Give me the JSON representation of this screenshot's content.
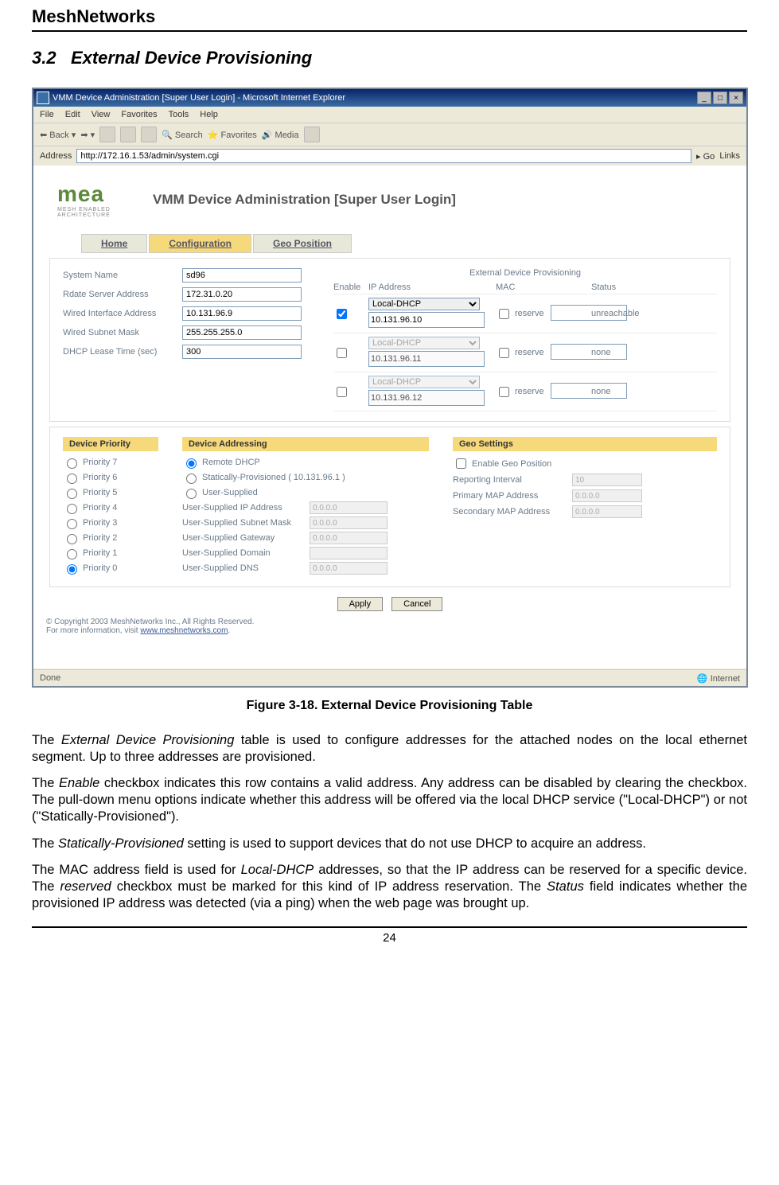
{
  "doc": {
    "header": "MeshNetworks",
    "section_number": "3.2",
    "section_title": "External Device Provisioning",
    "figure_caption": "Figure 3-18.    External Device Provisioning Table",
    "page_number": "24"
  },
  "paragraphs": {
    "p1_a": "The ",
    "p1_i": "External Device Provisioning",
    "p1_b": " table is used to configure addresses for the attached nodes on the local ethernet segment.  Up to three addresses are provisioned.",
    "p2_a": "The ",
    "p2_i": "Enable",
    "p2_b": " checkbox indicates this row contains a valid address.  Any address can be disabled by clearing the checkbox.  The pull-down menu options indicate whether this address will be offered via the local DHCP service (\"Local-DHCP\") or not (\"Statically-Provisioned\").",
    "p3_a": "The ",
    "p3_i": "Statically-Provisioned",
    "p3_b": " setting is used to support devices that do not use DHCP to acquire an address.",
    "p4_a": "The MAC address field is used for ",
    "p4_i1": "Local-DHCP",
    "p4_b": " addresses, so that the IP address can be reserved for a specific device.  The ",
    "p4_i2": "reserved",
    "p4_c": " checkbox must be marked for this kind of IP address reservation.  The ",
    "p4_i3": "Status",
    "p4_d": " field indicates whether the provisioned IP address was detected (via a ping) when the web page was brought up."
  },
  "browser": {
    "title": "VMM Device Administration [Super User Login] - Microsoft Internet Explorer",
    "menu": {
      "file": "File",
      "edit": "Edit",
      "view": "View",
      "favorites": "Favorites",
      "tools": "Tools",
      "help": "Help"
    },
    "toolbar": {
      "back": "Back",
      "search": "Search",
      "favorites": "Favorites",
      "media": "Media"
    },
    "address_label": "Address",
    "address_value": "http://172.16.1.53/admin/system.cgi",
    "go": "Go",
    "links": "Links",
    "status_done": "Done",
    "status_zone": "Internet"
  },
  "app": {
    "logo": "mea",
    "logo_sub": "MESH ENABLED ARCHITECTURE",
    "title": "VMM Device Administration [Super User Login]",
    "tabs": {
      "home": "Home",
      "config": "Configuration",
      "geo": "Geo Position"
    },
    "left_form": {
      "system_name": {
        "label": "System Name",
        "value": "sd96"
      },
      "rdate": {
        "label": "Rdate Server Address",
        "value": "172.31.0.20"
      },
      "wired_if": {
        "label": "Wired Interface Address",
        "value": "10.131.96.9"
      },
      "wired_mask": {
        "label": "Wired Subnet Mask",
        "value": "255.255.255.0"
      },
      "dhcp_lease": {
        "label": "DHCP Lease Time (sec)",
        "value": "300"
      }
    },
    "edp": {
      "title": "External Device Provisioning",
      "headers": {
        "enable": "Enable",
        "ip": "IP Address",
        "mac": "MAC",
        "status": "Status"
      },
      "reserve": "reserve",
      "rows": [
        {
          "enabled": true,
          "type": "Local-DHCP",
          "ip": "10.131.96.10",
          "status": "unreachable"
        },
        {
          "enabled": false,
          "type": "Local-DHCP",
          "ip": "10.131.96.11",
          "status": "none"
        },
        {
          "enabled": false,
          "type": "Local-DHCP",
          "ip": "10.131.96.12",
          "status": "none"
        }
      ]
    },
    "device_priority": {
      "title": "Device Priority",
      "items": [
        "Priority 7",
        "Priority 6",
        "Priority 5",
        "Priority 4",
        "Priority 3",
        "Priority 2",
        "Priority 1",
        "Priority 0"
      ]
    },
    "device_addressing": {
      "title": "Device Addressing",
      "remote": "Remote DHCP",
      "static": "Statically-Provisioned ( 10.131.96.1 )",
      "user": "User-Supplied",
      "fields": {
        "ip": "User-Supplied IP Address",
        "mask": "User-Supplied Subnet Mask",
        "gw": "User-Supplied Gateway",
        "domain": "User-Supplied Domain",
        "dns": "User-Supplied DNS"
      },
      "placeholder": "0.0.0.0"
    },
    "geo_settings": {
      "title": "Geo Settings",
      "enable": "Enable Geo Position",
      "reporting": {
        "label": "Reporting Interval",
        "value": "10"
      },
      "primary": {
        "label": "Primary MAP Address",
        "value": "0.0.0.0"
      },
      "secondary": {
        "label": "Secondary MAP Address",
        "value": "0.0.0.0"
      }
    },
    "buttons": {
      "apply": "Apply",
      "cancel": "Cancel"
    },
    "copyright": "© Copyright 2003 MeshNetworks Inc., All Rights Reserved.",
    "more_info": "For more information, visit ",
    "link": "www.meshnetworks.com"
  }
}
